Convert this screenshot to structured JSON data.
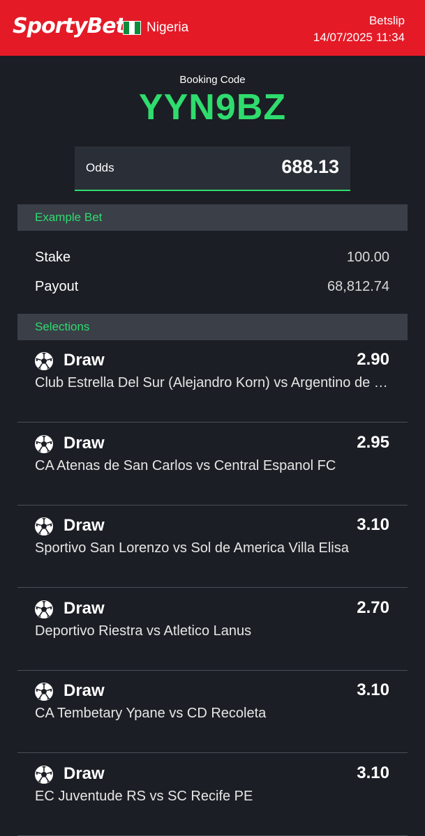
{
  "header": {
    "brand": "SportyBet",
    "country": "Nigeria",
    "title": "Betslip",
    "datetime": "14/07/2025 11:34",
    "flag_colors": [
      "#0a8c3a",
      "#ffffff",
      "#0a8c3a"
    ],
    "brand_color": "#e41a27"
  },
  "booking": {
    "label": "Booking Code",
    "code": "YYN9BZ",
    "accent_color": "#2fdc6e"
  },
  "odds": {
    "label": "Odds",
    "value": "688.13"
  },
  "example_bet": {
    "heading": "Example Bet",
    "stake_label": "Stake",
    "stake_value": "100.00",
    "payout_label": "Payout",
    "payout_value": "68,812.74"
  },
  "selections": {
    "heading": "Selections",
    "items": [
      {
        "icon": "soccer-ball-icon",
        "pick": "Draw",
        "odds": "2.90",
        "match": "Club Estrella Del Sur (Alejandro Korn) vs Argentino de Merlo"
      },
      {
        "icon": "soccer-ball-icon",
        "pick": "Draw",
        "odds": "2.95",
        "match": "CA Atenas de San Carlos vs Central Espanol FC"
      },
      {
        "icon": "soccer-ball-icon",
        "pick": "Draw",
        "odds": "3.10",
        "match": "Sportivo San Lorenzo vs Sol de America Villa Elisa"
      },
      {
        "icon": "soccer-ball-icon",
        "pick": "Draw",
        "odds": "2.70",
        "match": "Deportivo Riestra vs Atletico Lanus"
      },
      {
        "icon": "soccer-ball-icon",
        "pick": "Draw",
        "odds": "3.10",
        "match": "CA Tembetary Ypane vs CD Recoleta"
      },
      {
        "icon": "soccer-ball-icon",
        "pick": "Draw",
        "odds": "3.10",
        "match": "EC Juventude RS vs SC Recife PE"
      }
    ]
  }
}
